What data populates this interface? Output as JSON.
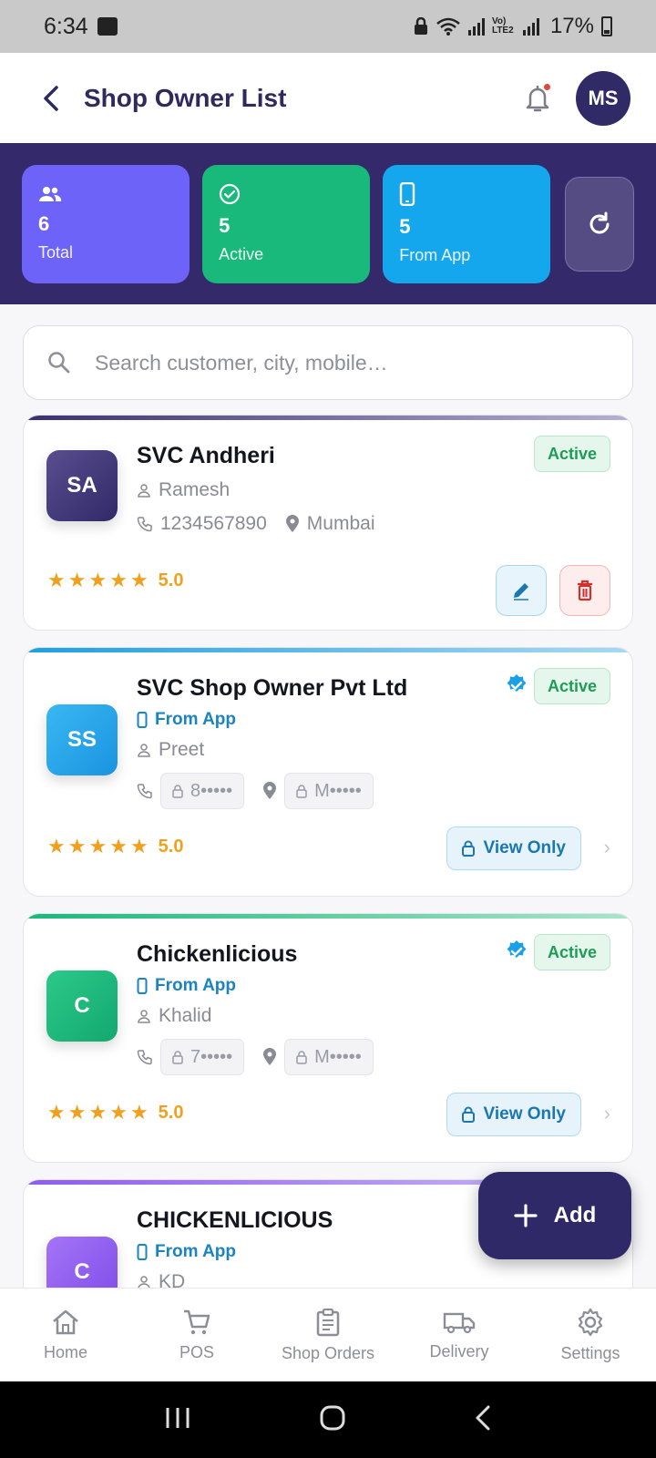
{
  "status_bar": {
    "time": "6:34",
    "network": "Vo) LTE2",
    "battery": "17%"
  },
  "app_bar": {
    "title": "Shop Owner List",
    "avatar_initials": "MS"
  },
  "stats": [
    {
      "value": "6",
      "label": "Total",
      "icon": "users-icon"
    },
    {
      "value": "5",
      "label": "Active",
      "icon": "check-circle-icon"
    },
    {
      "value": "5",
      "label": "From App",
      "icon": "phone-icon"
    }
  ],
  "search": {
    "placeholder": "Search customer, city, mobile…"
  },
  "shops": [
    {
      "initials": "SA",
      "name": "SVC Andheri",
      "status": "Active",
      "owner": "Ramesh",
      "phone": "1234567890",
      "city": "Mumbai",
      "rating": "5.0",
      "stars": 5
    },
    {
      "initials": "SS",
      "name": "SVC Shop Owner Pvt Ltd",
      "status": "Active",
      "source": "From App",
      "owner": "Preet",
      "phone_masked": "8•••••",
      "city_masked": "M•••••",
      "rating": "5.0",
      "stars": 5,
      "action": "View Only"
    },
    {
      "initials": "C",
      "name": "Chickenlicious",
      "status": "Active",
      "source": "From App",
      "owner": "Khalid",
      "phone_masked": "7•••••",
      "city_masked": "M•••••",
      "rating": "5.0",
      "stars": 5,
      "action": "View Only"
    },
    {
      "initials": "C",
      "name": "CHICKENLICIOUS",
      "source": "From App",
      "owner": "KD"
    }
  ],
  "fab": {
    "label": "Add"
  },
  "bottom_nav": [
    {
      "label": "Home",
      "icon": "home-icon"
    },
    {
      "label": "POS",
      "icon": "cart-icon"
    },
    {
      "label": "Shop Orders",
      "icon": "clipboard-icon"
    },
    {
      "label": "Delivery",
      "icon": "truck-icon"
    },
    {
      "label": "Settings",
      "icon": "gear-icon"
    }
  ],
  "colors": {
    "primary": "#2f2a67",
    "stats_band": "#34296b",
    "total": "#6d63f8",
    "active": "#18b97a",
    "from_app": "#15a7ee"
  }
}
